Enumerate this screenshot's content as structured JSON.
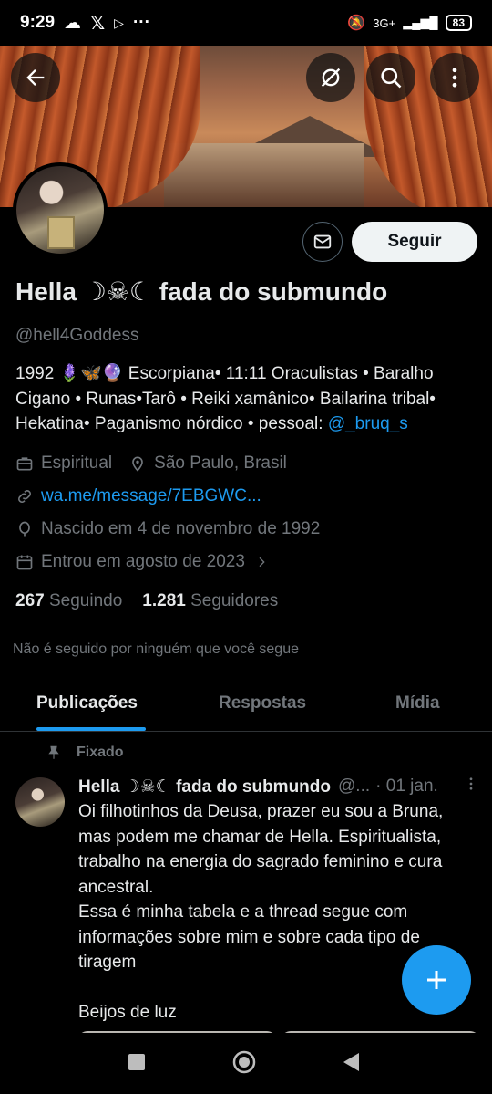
{
  "status_bar": {
    "time": "9:29",
    "network": "3G+",
    "battery": "83"
  },
  "profile": {
    "name": "Hella ☽☠︎☾ fada do submundo",
    "handle": "@hell4Goddess",
    "follow_label": "Seguir",
    "bio_text": "1992 🪻🦋🔮 Escorpiana• 11:11 Oraculistas • Baralho Cigano • Runas•Tarô • Reiki xamânico• Bailarina tribal• Hekatina• Paganismo nórdico • pessoal: ",
    "bio_mention": "@_bruq_s",
    "category": "Espiritual",
    "location": "São Paulo, Brasil",
    "website": "wa.me/message/7EBGWC...",
    "birth": "Nascido em 4 de novembro de 1992",
    "joined": "Entrou em agosto de 2023",
    "following_count": "267",
    "following_label": "Seguindo",
    "followers_count": "1.281",
    "followers_label": "Seguidores",
    "not_followed_text": "Não é seguido por ninguém que você segue"
  },
  "tabs": [
    {
      "label": "Publicações",
      "active": true
    },
    {
      "label": "Respostas",
      "active": false
    },
    {
      "label": "Mídia",
      "active": false
    }
  ],
  "pinned_tweet": {
    "pinned_label": "Fixado",
    "author": "Hella ☽☠︎☾ fada do submundo",
    "handle": "@...",
    "date": "· 01 jan.",
    "text": "Oi filhotinhos da Deusa, prazer eu sou a Bruna, mas podem me chamar de Hella. Espiritualista, trabalho na energia do sagrado feminino e cura ancestral.\nEssa é minha tabela e a thread segue com informações sobre mim e sobre cada tipo de tiragem\n\nBeijos de luz"
  },
  "colors": {
    "accent": "#1d9bf0",
    "background": "#000000",
    "muted": "#71767b",
    "text": "#e7e9ea"
  },
  "icons": {
    "back": "arrow-left-icon",
    "unfollow_topic": "no-sync-icon",
    "search": "search-icon",
    "more": "more-vertical-icon",
    "mail": "mail-icon",
    "category": "briefcase-icon",
    "location": "location-pin-icon",
    "link": "link-icon",
    "birth": "balloon-icon",
    "joined": "calendar-icon",
    "pinned": "pin-icon",
    "compose": "plus-icon"
  }
}
